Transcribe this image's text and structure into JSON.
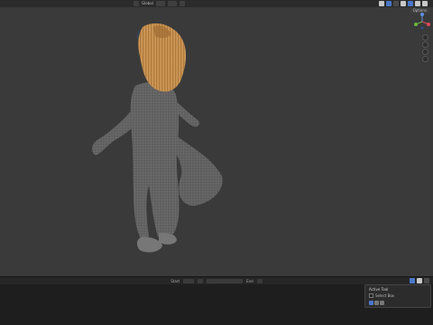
{
  "header": {
    "mode_label": "Global",
    "options_label": "Options"
  },
  "timeline": {
    "start_label": "Start",
    "end_label": "End"
  },
  "operator_panel": {
    "title": "Active Tool",
    "item_label": "Select Box"
  },
  "colors": {
    "viewport_bg": "#3a3a3a",
    "header_bg": "#2b2b2b",
    "timeline_bg": "#1e1e1e",
    "accent_blue": "#4a78c8",
    "hair": "#c8934f",
    "body_mesh": "#6a6a6a"
  },
  "icons": [
    "transform-orientation-icon",
    "pivot-icon",
    "snap-icon",
    "proportional-edit-icon",
    "navigation-gizmo-icon",
    "zoom-icon",
    "pan-icon",
    "camera-icon",
    "grid-icon",
    "play-icon",
    "keyframe-icon"
  ]
}
